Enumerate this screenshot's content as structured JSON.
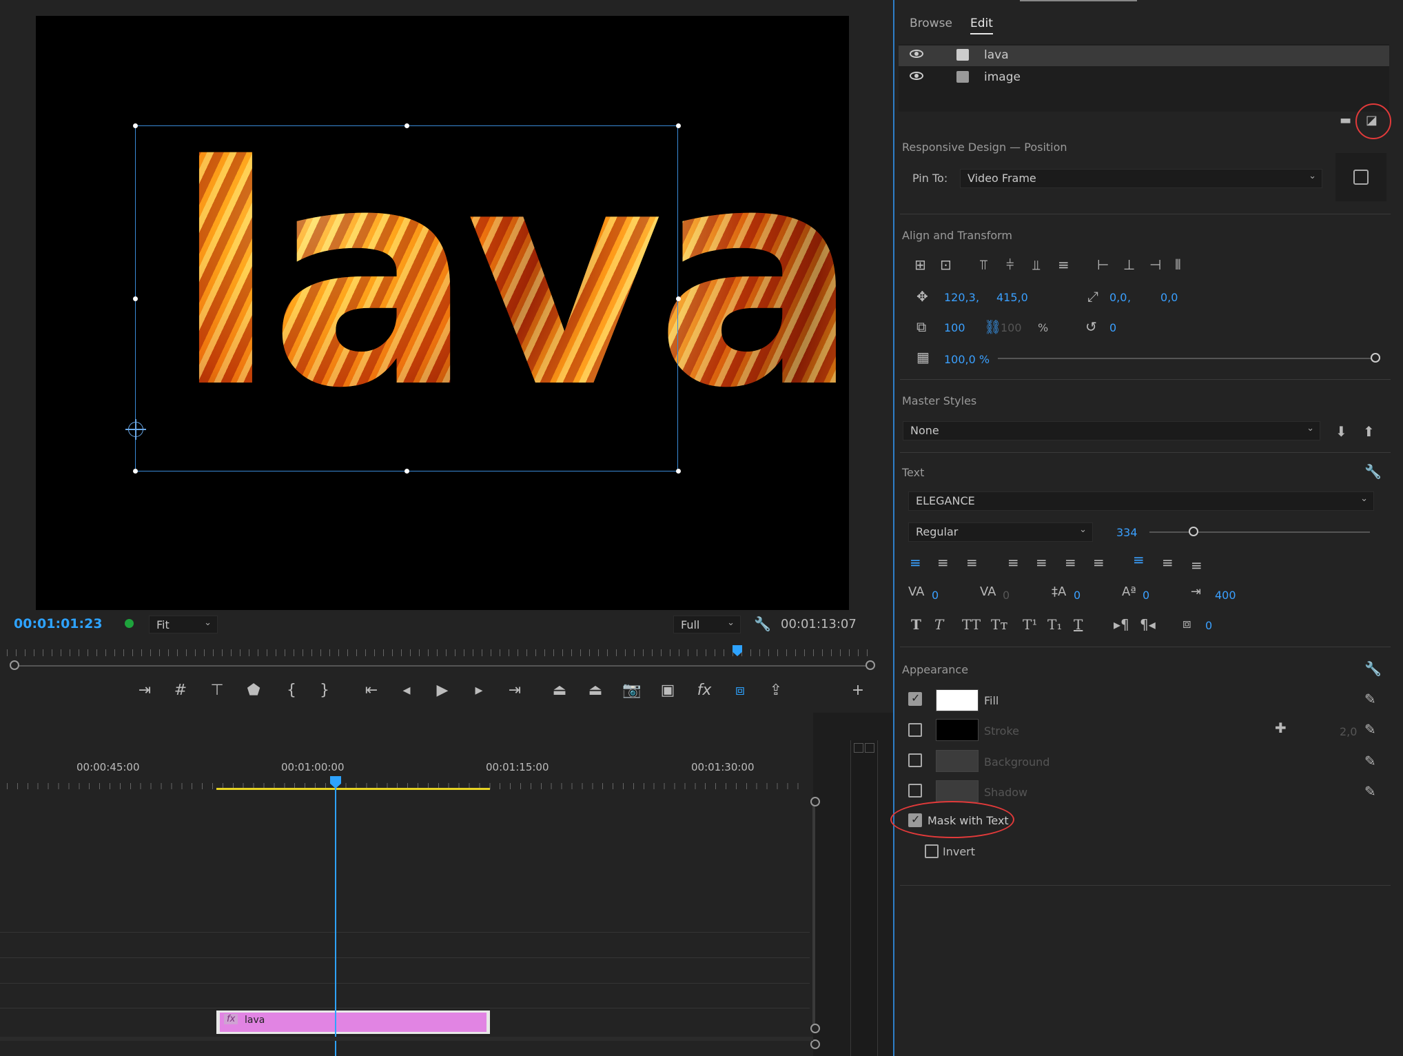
{
  "monitor": {
    "overlay_text": "lava",
    "current_timecode": "00:01:01:23",
    "fit_label": "Fit",
    "quality_label": "Full",
    "duration_timecode": "00:01:13:07"
  },
  "timeline": {
    "ruler": [
      "00:00:45:00",
      "00:01:00:00",
      "00:01:15:00",
      "00:01:30:00"
    ],
    "clip": {
      "fx": "fx",
      "label": "lava"
    }
  },
  "panel": {
    "tabs": {
      "browse": "Browse",
      "edit": "Edit"
    },
    "layers": [
      {
        "name": "lava",
        "selected": true
      },
      {
        "name": "image",
        "selected": false
      }
    ],
    "responsive": {
      "title": "Responsive Design — Position",
      "pin_label": "Pin To:",
      "pin_value": "Video Frame"
    },
    "align": {
      "title": "Align and Transform",
      "pos_x": "120,3",
      "pos_sep": ",",
      "pos_y": "415,0",
      "anchor_x": "0,0",
      "anchor_sep": ",",
      "anchor_y": "0,0",
      "scale": "100",
      "scale_h": "100",
      "scale_unit": "%",
      "rotation": "0",
      "opacity": "100,0 %"
    },
    "master": {
      "title": "Master Styles",
      "value": "None"
    },
    "text": {
      "title": "Text",
      "font": "ELEGANCE",
      "style": "Regular",
      "size": "334",
      "kerning": "0",
      "tracking": "0",
      "leading": "0",
      "baseline": "0",
      "tab_width": "400",
      "tsume": "0"
    },
    "appearance": {
      "title": "Appearance",
      "fill": "Fill",
      "stroke": "Stroke",
      "stroke_width": "2,0",
      "background": "Background",
      "shadow": "Shadow",
      "mask": "Mask with Text",
      "invert": "Invert"
    }
  },
  "colors": {
    "accent": "#2ea3ff",
    "clip": "#e184e3",
    "highlight_circle": "#e23a3a",
    "workarea": "#e7d324"
  }
}
